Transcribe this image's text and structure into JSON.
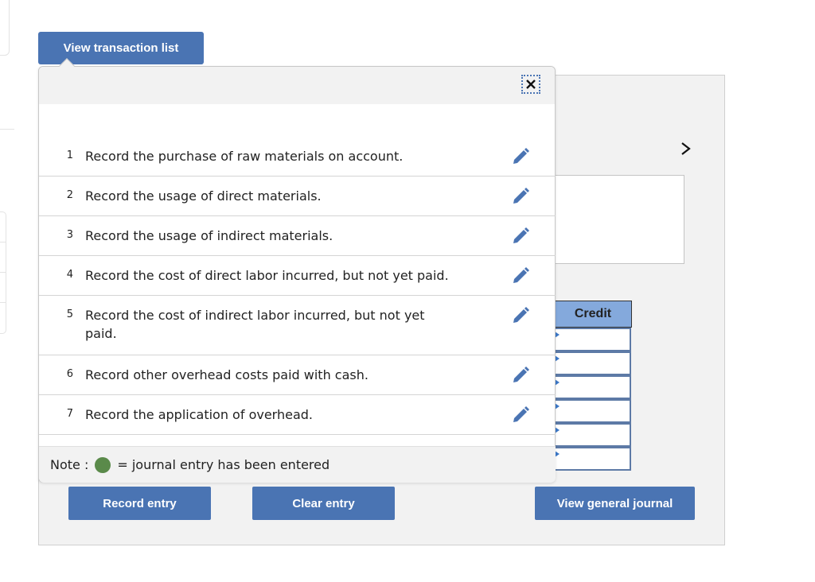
{
  "header": {
    "view_list_label": "View transaction list"
  },
  "popup": {
    "close_icon": "close-icon",
    "transactions": [
      {
        "number": "1",
        "description": "Record the purchase of raw materials on account.",
        "entered": false
      },
      {
        "number": "2",
        "description": "Record the usage of direct materials.",
        "entered": false
      },
      {
        "number": "3",
        "description": "Record the usage of indirect materials.",
        "entered": false
      },
      {
        "number": "4",
        "description": "Record the cost of direct labor incurred, but not yet paid.",
        "entered": false
      },
      {
        "number": "5",
        "description": "Record the cost of indirect labor incurred, but not yet paid.",
        "entered": false
      },
      {
        "number": "6",
        "description": "Record other overhead costs paid with cash.",
        "entered": false
      },
      {
        "number": "7",
        "description": "Record the application of overhead.",
        "entered": false
      }
    ],
    "note": {
      "prefix": "Note :",
      "suffix": "= journal entry has been entered",
      "dot_color": "#5a8a4a"
    }
  },
  "journal": {
    "next_icon": "chevron-right-icon",
    "credit_header": "Credit",
    "credit_values": [
      "",
      "",
      "",
      "",
      "",
      ""
    ]
  },
  "buttons": {
    "record": "Record entry",
    "clear": "Clear entry",
    "general": "View general journal"
  },
  "colors": {
    "button_blue": "#4a74b3",
    "header_blue": "#84a9dc",
    "entered_green": "#5a8a4a"
  }
}
